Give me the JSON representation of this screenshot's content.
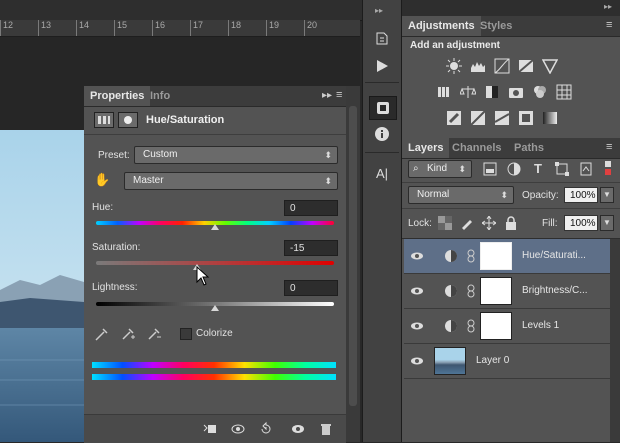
{
  "ruler": {
    "ticks": [
      "12",
      "13",
      "14",
      "15",
      "16",
      "17",
      "18",
      "19",
      "20"
    ]
  },
  "properties": {
    "tabs": [
      {
        "label": "Properties"
      },
      {
        "label": "Info"
      }
    ],
    "title": "Hue/Saturation",
    "preset_label": "Preset:",
    "preset_value": "Custom",
    "range_value": "Master",
    "hue_label": "Hue:",
    "hue_value": "0",
    "saturation_label": "Saturation:",
    "saturation_value": "-15",
    "lightness_label": "Lightness:",
    "lightness_value": "0",
    "colorize_label": "Colorize",
    "hue_level": 0,
    "saturation_level": -15,
    "lightness_level": 0
  },
  "adjustments": {
    "tabs": [
      {
        "label": "Adjustments"
      },
      {
        "label": "Styles"
      }
    ],
    "heading": "Add an adjustment"
  },
  "layers": {
    "tabs": [
      {
        "label": "Layers"
      },
      {
        "label": "Channels"
      },
      {
        "label": "Paths"
      }
    ],
    "kind_label": "Kind",
    "blend_mode": "Normal",
    "opacity_label": "Opacity:",
    "opacity_value": "100%",
    "lock_label": "Lock:",
    "fill_label": "Fill:",
    "fill_value": "100%",
    "items": [
      {
        "name": "Hue/Saturati..."
      },
      {
        "name": "Brightness/C..."
      },
      {
        "name": "Levels 1"
      },
      {
        "name": "Layer 0"
      }
    ]
  },
  "colors": {
    "selection": "#5e6f88",
    "panel": "#535353",
    "field": "#2d2d2d"
  }
}
